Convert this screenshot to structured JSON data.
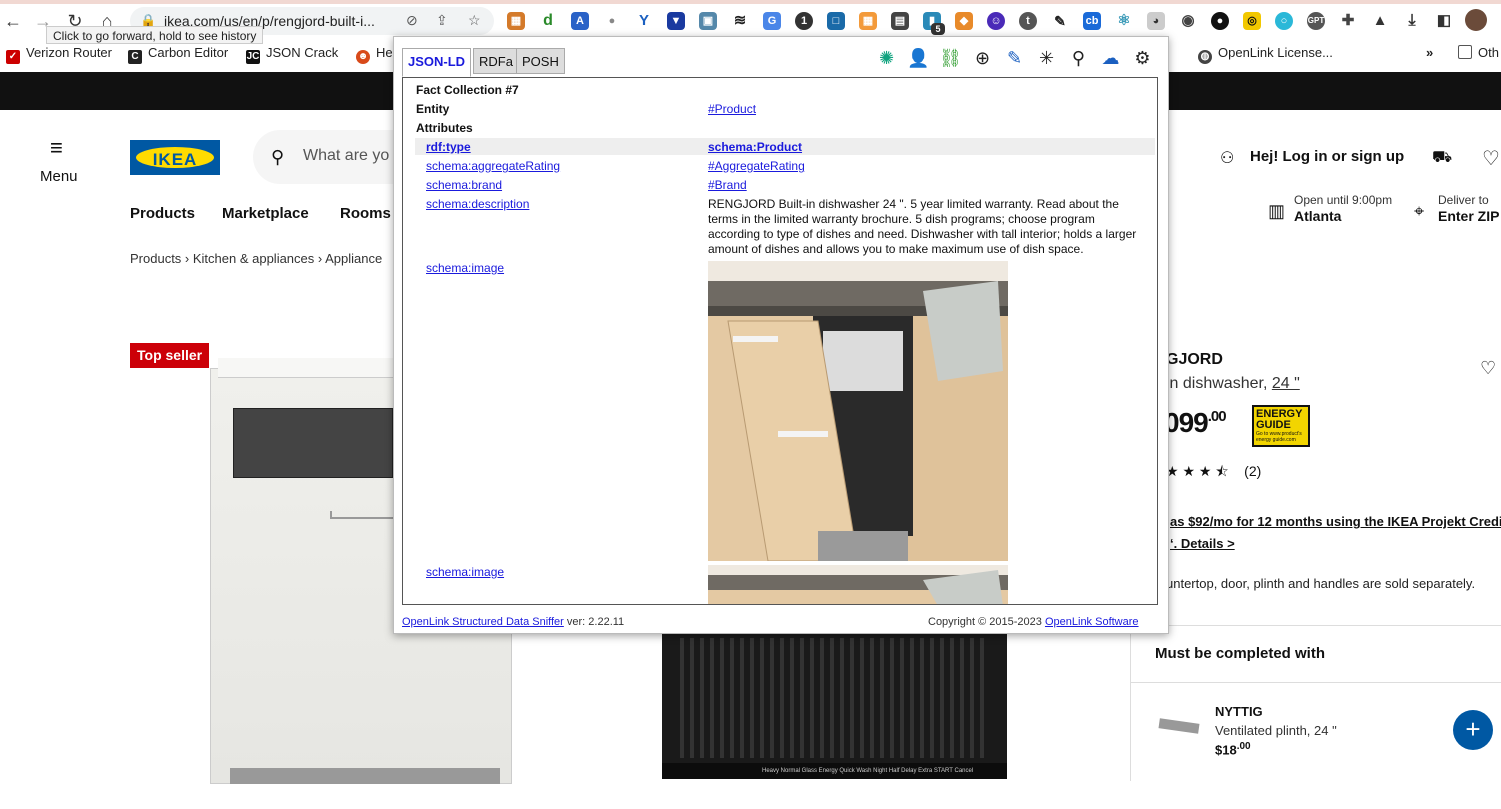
{
  "browser": {
    "url": "ikea.com/us/en/p/rengjord-built-i...",
    "tooltip": "Click to go forward, hold to see history",
    "extension_badge": "5",
    "bookmarks": [
      "Verizon Router",
      "Carbon Editor",
      "JSON Crack",
      "He",
      "OpenLink License...",
      "Oth"
    ],
    "more_bookmarks": "»"
  },
  "ikea": {
    "menu_label": "Menu",
    "logo_text": "IKEA",
    "search_placeholder": "What are yo",
    "nav": [
      "Products",
      "Marketplace",
      "Rooms"
    ],
    "breadcrumb": "Products  ›  Kitchen & appliances  ›  Appliance",
    "login": "Hej! Log in or sign up",
    "store_small": "Open until 9:00pm",
    "store_big": "Atlanta",
    "deliver_small": "Deliver to",
    "deliver_big": "Enter ZIP",
    "top_seller": "Top seller",
    "product_name": "GJORD",
    "product_desc_prefix": "in dishwasher, ",
    "product_desc_size": "24 \"",
    "price_main": "099",
    "price_cents": ".00",
    "energy_label": "ENERGY GUIDE",
    "energy_small": "Go to www.product's energy guide.com",
    "rating_count": "(2)",
    "credit_line1": " as $92/mo for 12 months using the IKEA Projekt Credit",
    "credit_line2": "‘. Details >",
    "countertop_note": "untertop, door, plinth and handles are sold separately.",
    "must_title": "Must be completed with",
    "nyttig_name": "NYTTIG",
    "nyttig_desc": "Ventilated plinth, 24 \"",
    "nyttig_price_main": "$18",
    "nyttig_price_cents": ".00",
    "dw2_panel": "Heavy Normal Glass Energy Quick   Wash  Night  Half  Delay  Extra        START Cancel"
  },
  "sniffer": {
    "tabs": [
      "JSON-LD",
      "RDFa",
      "POSH"
    ],
    "collection_title": "Fact Collection #7",
    "entity_label": "Entity",
    "entity_value": "#Product",
    "attributes_label": "Attributes",
    "rows": [
      {
        "key": "rdf:type",
        "value": "schema:Product"
      },
      {
        "key": "schema:aggregateRating",
        "value": "#AggregateRating"
      },
      {
        "key": "schema:brand",
        "value": "#Brand"
      },
      {
        "key": "schema:description",
        "value": ""
      },
      {
        "key": "schema:image",
        "value": ""
      },
      {
        "key": "schema:image",
        "value": ""
      }
    ],
    "description": "RENGJORD Built-in dishwasher 24 \". 5 year limited warranty. Read about the terms in the limited warranty brochure. 5 dish programs; choose program according to type of dishes and need. Dishwasher with tall interior; holds a larger amount of dishes and allows you to make maximum use of dish space.",
    "footer_link": "OpenLink Structured Data Sniffer",
    "footer_version": " ver: 2.22.11",
    "copyright_prefix": "Copyright © 2015-2023 ",
    "copyright_link": "OpenLink Software"
  },
  "colors": {
    "ikea_blue": "#0058a3",
    "ikea_yellow": "#ffdb00",
    "top_seller_red": "#cc0008",
    "link_blue": "#1a1add"
  }
}
